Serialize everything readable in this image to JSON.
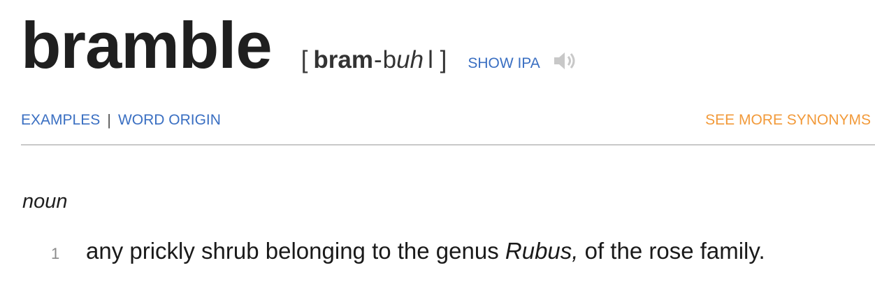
{
  "entry": {
    "headword": "bramble",
    "pronunciation": {
      "open_bracket": "[",
      "stressed": "bram",
      "hyphen": "-",
      "unstressed_plain": "b",
      "unstressed_italic": "uh",
      "close": "l ]"
    },
    "show_ipa_label": "SHOW IPA",
    "audio_icon": "speaker-icon"
  },
  "nav": {
    "examples_label": "EXAMPLES",
    "separator": "|",
    "word_origin_label": "WORD ORIGIN",
    "see_more_label": "SEE MORE SYNONYMS"
  },
  "definitions": {
    "part_of_speech": "noun",
    "items": [
      {
        "number": "1",
        "text_before": "any prickly shrub belonging to the genus ",
        "text_italic": "Rubus,",
        "text_after": " of the rose family."
      }
    ]
  },
  "colors": {
    "link_blue": "#3a6fc2",
    "accent_orange": "#f29a3a",
    "divider": "#c9c9c9"
  }
}
